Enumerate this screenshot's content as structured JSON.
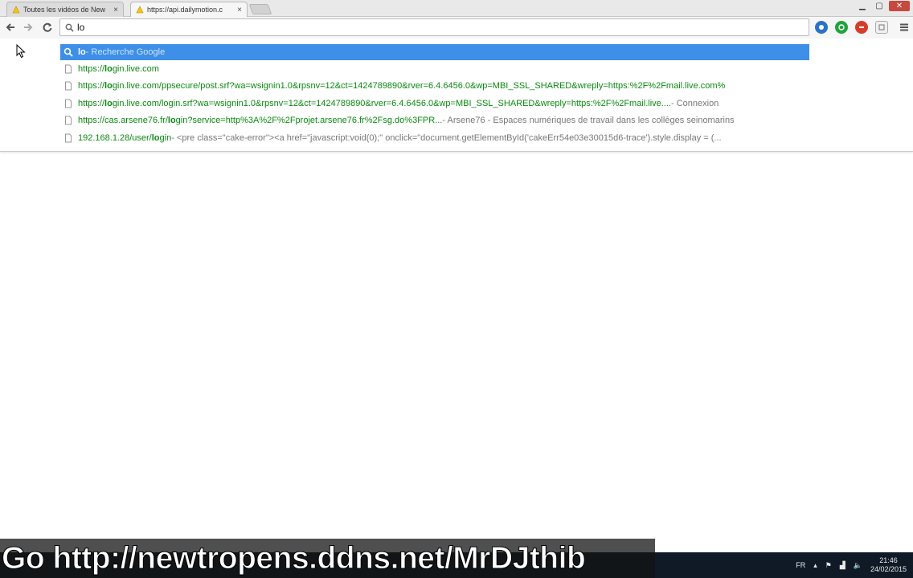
{
  "tabs": [
    {
      "title": "Toutes les vidéos de New",
      "close": "×"
    },
    {
      "title": "https://api.dailymotion.c",
      "close": "×"
    }
  ],
  "omnibox": {
    "value": "lo"
  },
  "suggestions": [
    {
      "url_pre": "lo",
      "url_rest": "",
      "desc": " - Recherche Google",
      "type": "search"
    },
    {
      "url_pre": "https://",
      "bold": "lo",
      "url_rest": "gin.live.com",
      "desc": "",
      "type": "page"
    },
    {
      "url_pre": "https://",
      "bold": "lo",
      "url_rest": "gin.live.com/ppsecure/post.srf?wa=wsignin1.0&rpsnv=12&ct=1424789890&rver=6.4.6456.0&wp=MBI_SSL_SHARED&wreply=https:%2F%2Fmail.live.com%",
      "desc": "",
      "type": "page"
    },
    {
      "url_pre": "https://",
      "bold": "lo",
      "url_rest": "gin.live.com/login.srf?wa=wsignin1.0&rpsnv=12&ct=1424789890&rver=6.4.6456.0&wp=MBI_SSL_SHARED&wreply=https:%2F%2Fmail.live....",
      "desc": " - Connexion",
      "type": "page"
    },
    {
      "url_pre": "https://cas.arsene76.fr/",
      "bold": "lo",
      "url_rest": "gin?service=http%3A%2F%2Fprojet.arsene76.fr%2Fsg.do%3FPR...",
      "desc": "   - Arsene76 - Espaces numériques de travail dans les collèges seinomarins",
      "type": "page"
    },
    {
      "url_pre": "192.168.1.28/user/",
      "bold": "lo",
      "url_rest": "gin",
      "desc": " - <pre class=\"cake-error\"><a href=\"javascript:void(0);\" onclick=\"document.getElementById('cakeErr54e03e30015d6-trace').style.display = (...",
      "type": "page"
    }
  ],
  "taskbar": {
    "lang": "FR",
    "time": "21:46",
    "date": "24/02/2015"
  },
  "banner": {
    "text": "Go http://newtropens.ddns.net/MrDJthib"
  },
  "colors": {
    "selected": "#3d8fe8",
    "url_green": "#0b8a11"
  }
}
